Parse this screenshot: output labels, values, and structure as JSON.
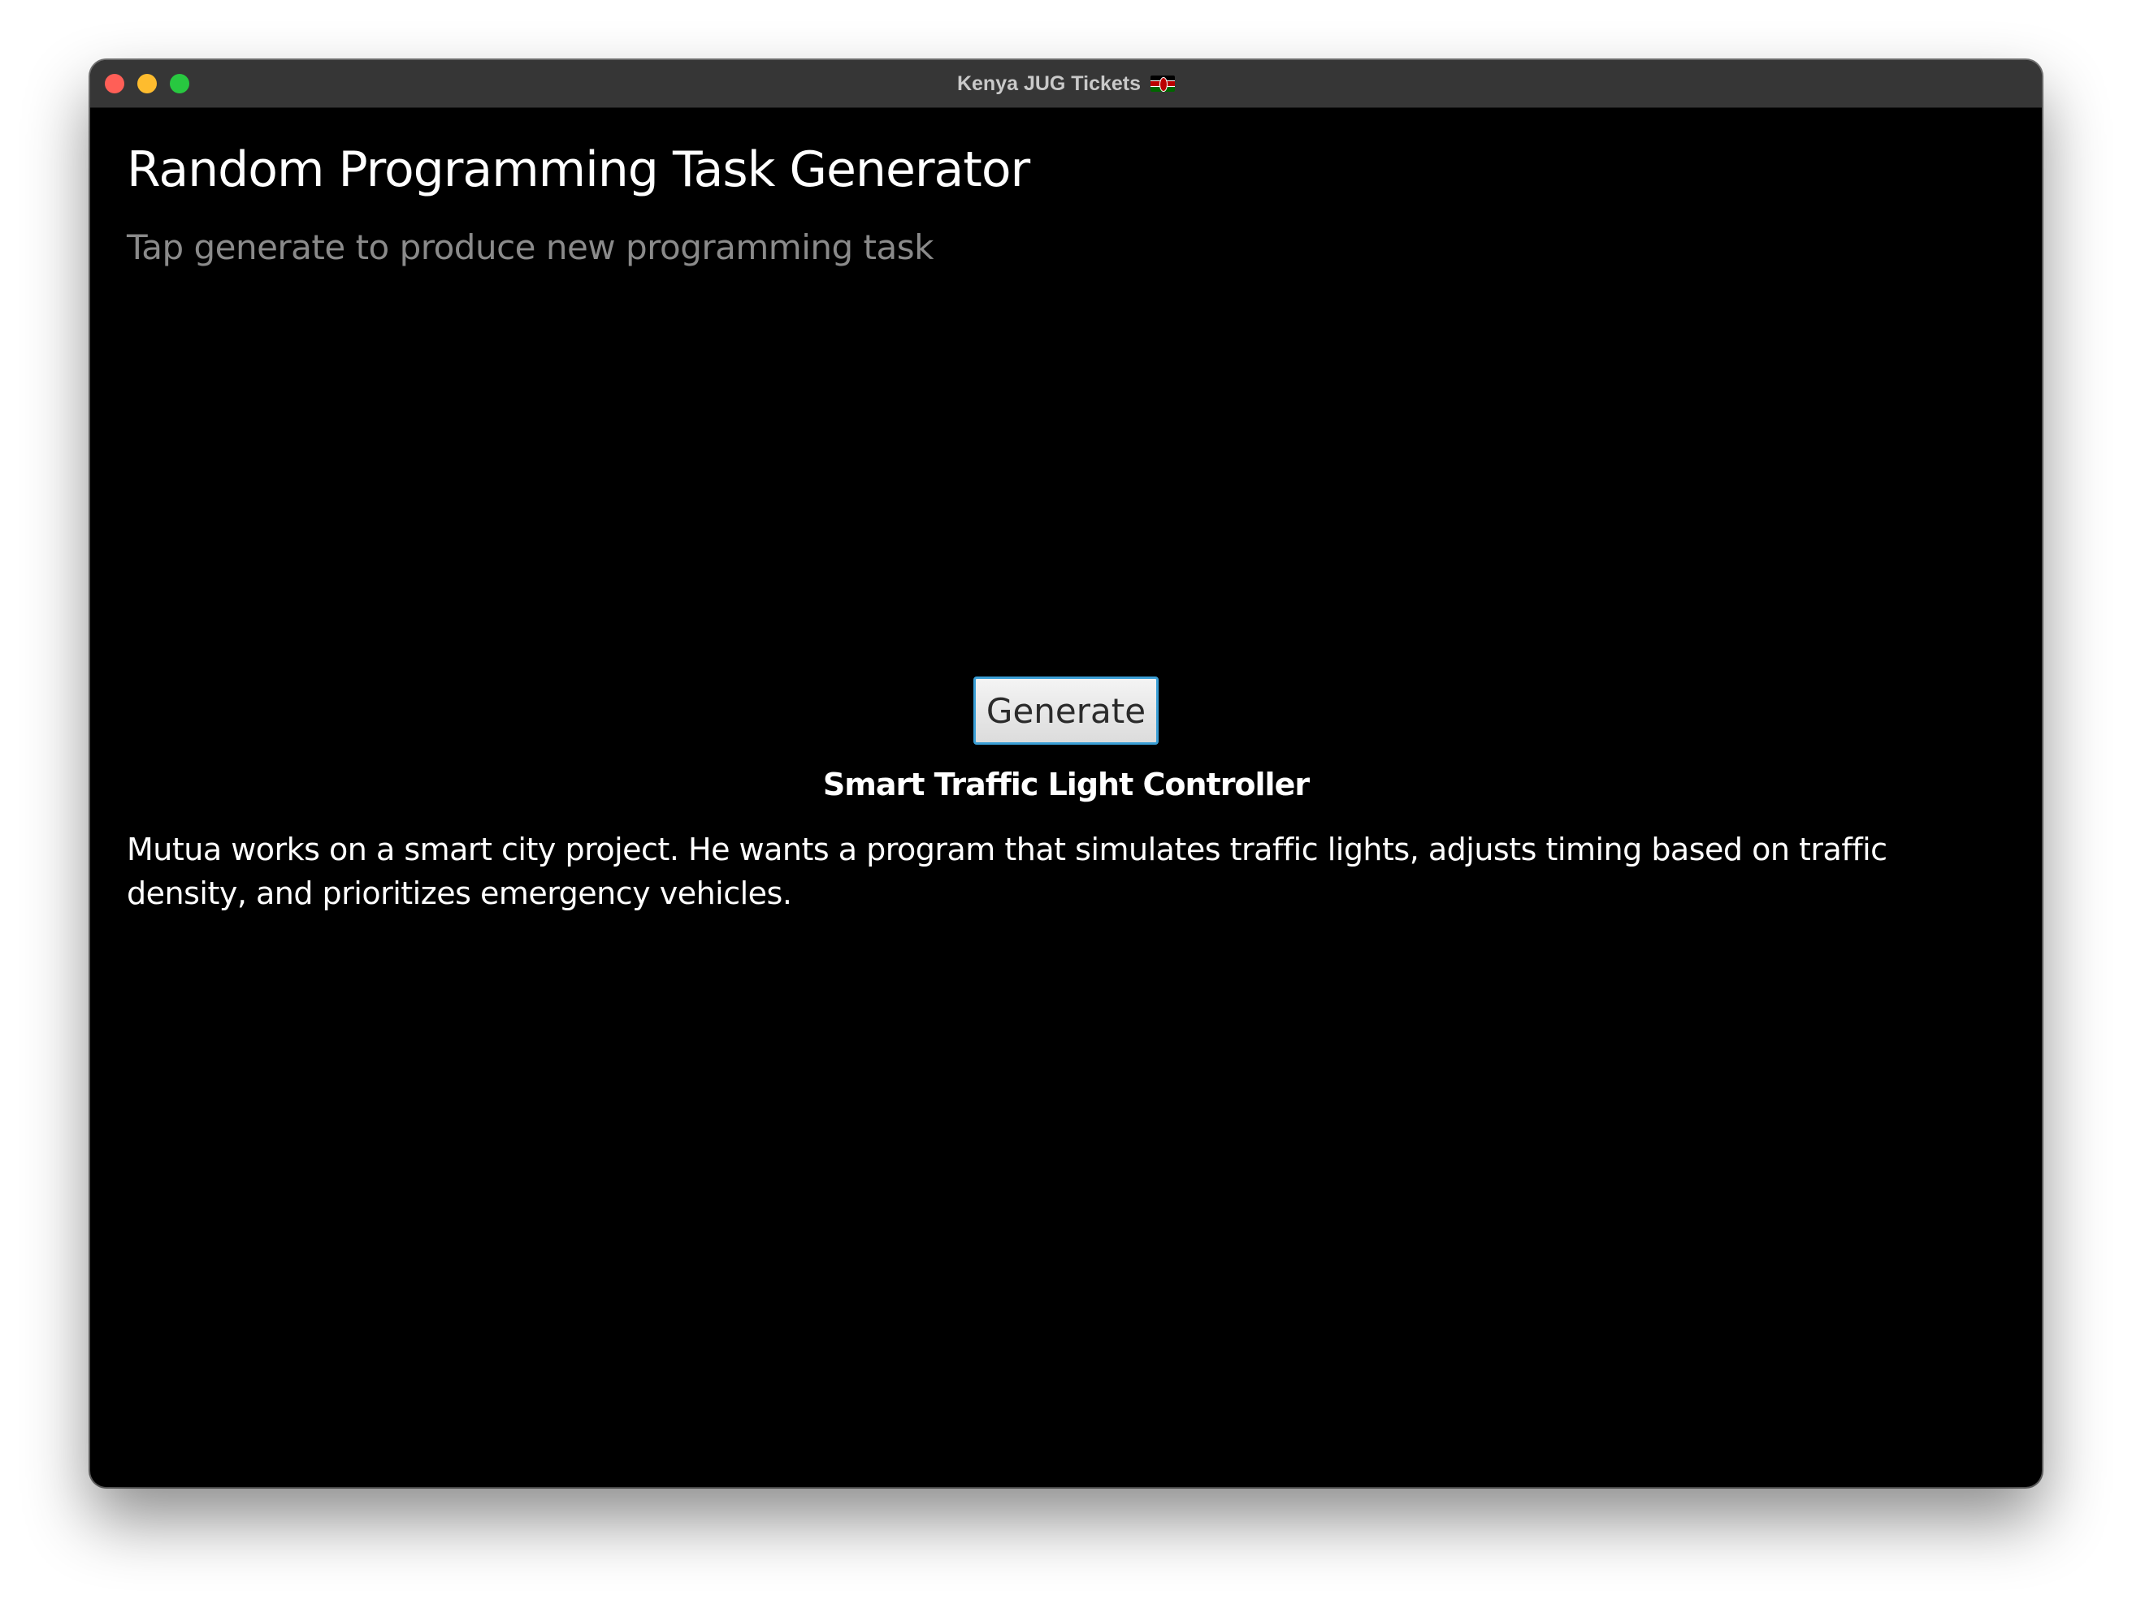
{
  "window": {
    "title": "Kenya JUG Tickets",
    "title_icon": "kenya-flag-icon"
  },
  "main": {
    "heading": "Random Programming Task Generator",
    "subheading": "Tap generate to produce new programming task",
    "generate_label": "Generate",
    "task": {
      "title": "Smart Traffic Light Controller",
      "description": "Mutua works on a smart city project. He wants a program that simulates traffic lights, adjusts timing based on traffic density, and prioritizes emergency vehicles."
    }
  },
  "colors": {
    "background": "#000000",
    "titlebar": "#363636",
    "button_border": "#3b9fd6",
    "subheading": "#8a8a8a"
  }
}
